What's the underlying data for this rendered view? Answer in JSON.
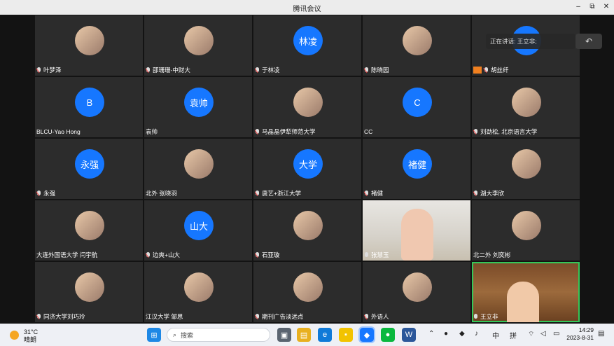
{
  "window": {
    "title": "腾讯会议"
  },
  "window_controls": {
    "minimize": "–",
    "restore": "⧉",
    "close": "✕"
  },
  "overlay": {
    "speaking_text": "正在讲话: 王立非;"
  },
  "participants": [
    {
      "name": "叶梦泽",
      "avatar": "photo",
      "mic": "muted"
    },
    {
      "name": "邵珊珊-中财大",
      "avatar": "photo",
      "mic": "muted"
    },
    {
      "name": "于林凌",
      "avatar": "text",
      "avatar_text": "林凌",
      "mic": "muted"
    },
    {
      "name": "陈晓园",
      "avatar": "photo",
      "mic": "muted"
    },
    {
      "name": "胡丝纤",
      "avatar": "text",
      "avatar_text": "",
      "mic": "muted",
      "host_badge": true
    },
    {
      "name": "BLCU-Yao Hong",
      "avatar": "text",
      "avatar_text": "B",
      "mic": "none"
    },
    {
      "name": "袁帅",
      "avatar": "text",
      "avatar_text": "袁帅",
      "mic": "none"
    },
    {
      "name": "马晶晶伊犁师范大学",
      "avatar": "photo",
      "mic": "muted"
    },
    {
      "name": "CC",
      "avatar": "text",
      "avatar_text": "C",
      "mic": "none"
    },
    {
      "name": "刘劲松, 北京语言大学",
      "avatar": "photo",
      "mic": "muted"
    },
    {
      "name": "永强",
      "avatar": "text",
      "avatar_text": "永强",
      "mic": "muted"
    },
    {
      "name": "北外 张晓羽",
      "avatar": "photo",
      "mic": "none"
    },
    {
      "name": "唐艺+浙江大学",
      "avatar": "text",
      "avatar_text": "大学",
      "mic": "muted"
    },
    {
      "name": "褚健",
      "avatar": "text",
      "avatar_text": "褚健",
      "mic": "muted"
    },
    {
      "name": "湖大李欣",
      "avatar": "photo",
      "mic": "muted"
    },
    {
      "name": "大连外国语大学 闫宇航",
      "avatar": "photo",
      "mic": "none"
    },
    {
      "name": "边爽+山大",
      "avatar": "text",
      "avatar_text": "山大",
      "mic": "muted"
    },
    {
      "name": "石亚璇",
      "avatar": "photo",
      "mic": "muted"
    },
    {
      "name": "张慧玉",
      "avatar": "video",
      "mic": "on"
    },
    {
      "name": "北二外 刘奕彬",
      "avatar": "photo",
      "mic": "none"
    },
    {
      "name": "同济大学刘巧玲",
      "avatar": "photo",
      "mic": "muted"
    },
    {
      "name": "江汉大学 邹思",
      "avatar": "photo",
      "mic": "none"
    },
    {
      "name": "期刊广告淡远点",
      "avatar": "photo",
      "mic": "muted"
    },
    {
      "name": "外语人",
      "avatar": "photo",
      "mic": "muted"
    },
    {
      "name": "王立非",
      "avatar": "video-man",
      "mic": "on",
      "speaking": true
    }
  ],
  "taskbar": {
    "weather_temp": "31°C",
    "weather_desc": "晴朗",
    "search_placeholder": "搜索",
    "ime_lang": "中",
    "ime_mode": "拼",
    "time": "14:29",
    "date": "2023-8-31",
    "accent": "#1677ff"
  }
}
